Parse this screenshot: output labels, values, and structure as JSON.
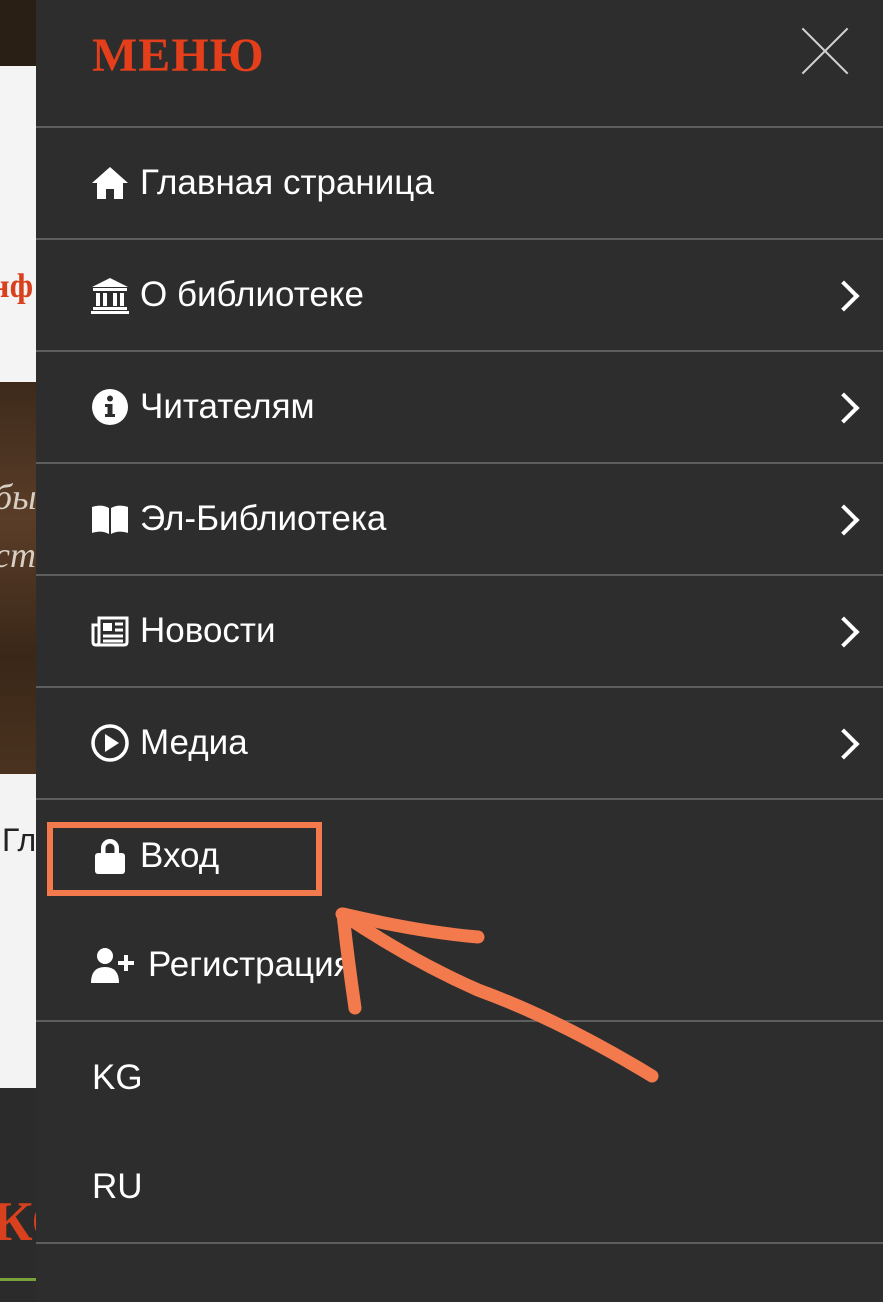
{
  "drawer": {
    "title": "МЕНЮ",
    "close_icon": "close-icon",
    "items": [
      {
        "label": "Главная страница",
        "icon": "home-icon",
        "has_submenu": false
      },
      {
        "label": "О библиотеке",
        "icon": "landmark-icon",
        "has_submenu": true
      },
      {
        "label": "Читателям",
        "icon": "info-circle-icon",
        "has_submenu": true
      },
      {
        "label": "Эл-Библиотека",
        "icon": "book-open-icon",
        "has_submenu": true
      },
      {
        "label": "Новости",
        "icon": "newspaper-icon",
        "has_submenu": true
      },
      {
        "label": "Медиа",
        "icon": "play-circle-icon",
        "has_submenu": true
      },
      {
        "label": "Вход",
        "icon": "lock-icon",
        "has_submenu": false
      },
      {
        "label": "Регистрация",
        "icon": "user-plus-icon",
        "has_submenu": false
      }
    ],
    "languages": [
      "KG",
      "RU"
    ]
  },
  "colors": {
    "drawer_bg": "#2d2d2d",
    "title": "#e43f1a",
    "divider": "#5e5e5e",
    "annotation": "#f37a4c"
  }
}
